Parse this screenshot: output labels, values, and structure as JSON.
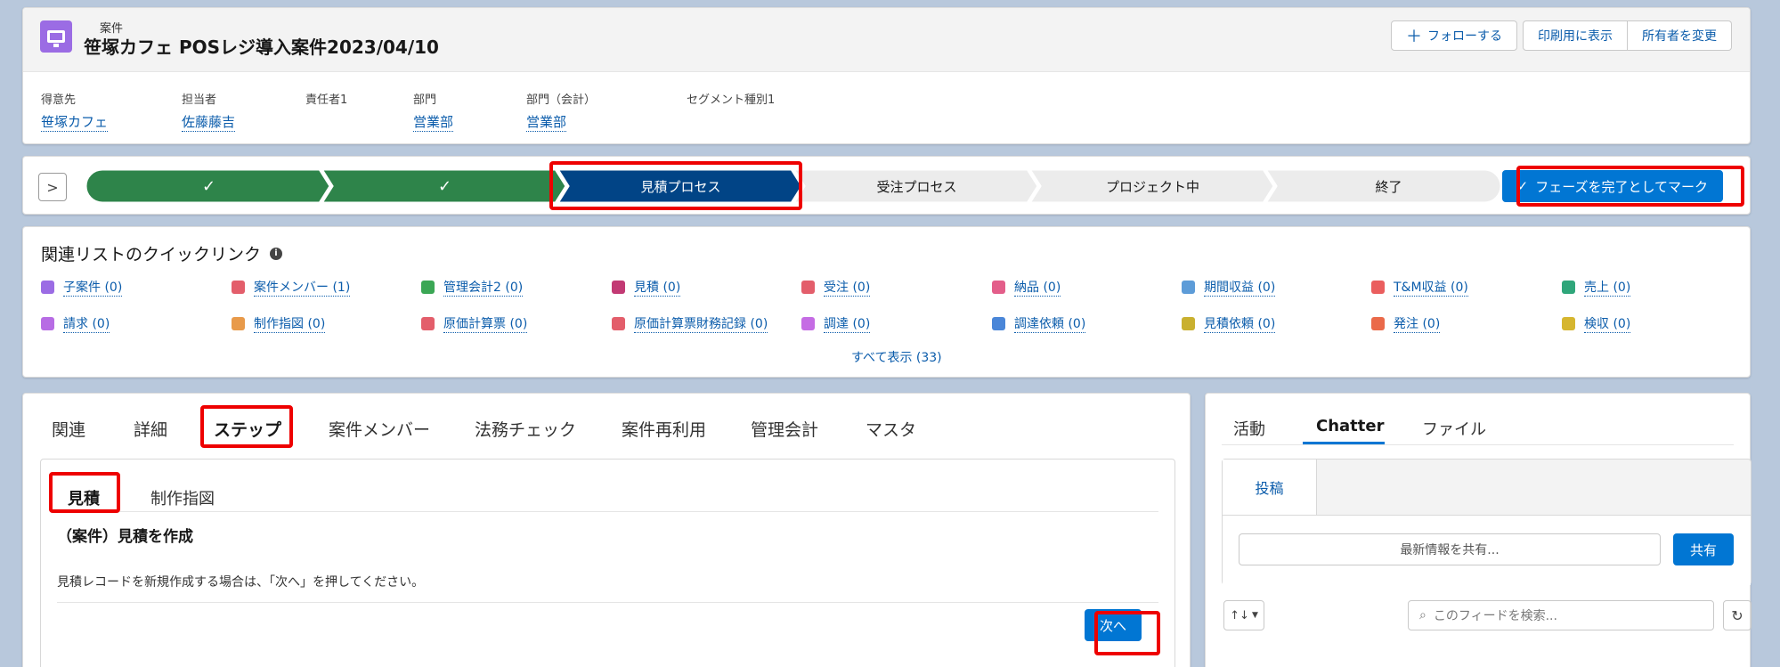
{
  "header": {
    "object_label": "案件",
    "record_title": "笹塚カフェ POSレジ導入案件2023/04/10",
    "buttons": {
      "follow": "フォローする",
      "printable": "印刷用に表示",
      "change_owner": "所有者を変更"
    },
    "fields": [
      {
        "label": "得意先",
        "value": "笹塚カフェ"
      },
      {
        "label": "担当者",
        "value": "佐藤藤吉"
      },
      {
        "label": "責任者1",
        "value": ""
      },
      {
        "label": "部門",
        "value": "営業部"
      },
      {
        "label": "部門（会計）",
        "value": "営業部"
      },
      {
        "label": "セグメント種別1",
        "value": ""
      }
    ]
  },
  "path": {
    "stages": [
      {
        "label": "✓",
        "status": "complete"
      },
      {
        "label": "✓",
        "status": "complete"
      },
      {
        "label": "見積プロセス",
        "status": "current"
      },
      {
        "label": "受注プロセス",
        "status": "incomplete"
      },
      {
        "label": "プロジェクト中",
        "status": "incomplete"
      },
      {
        "label": "終了",
        "status": "incomplete"
      }
    ],
    "mark_complete_button": "フェーズを完了としてマーク",
    "colors": {
      "complete": "#2e844a",
      "current": "#014486",
      "incomplete": "#ececec"
    }
  },
  "quick_links": {
    "title": "関連リストのクイックリンク",
    "items": [
      {
        "label": "子案件 (0)",
        "color": "#9b6ce4"
      },
      {
        "label": "案件メンバー (1)",
        "color": "#e35e6b"
      },
      {
        "label": "管理会計2 (0)",
        "color": "#3ba755"
      },
      {
        "label": "見積 (0)",
        "color": "#c23a74"
      },
      {
        "label": "受注 (0)",
        "color": "#e35e6b"
      },
      {
        "label": "納品 (0)",
        "color": "#e35e8a"
      },
      {
        "label": "期間収益 (0)",
        "color": "#5d9cd8"
      },
      {
        "label": "T&M収益 (0)",
        "color": "#ea5e5e"
      },
      {
        "label": "売上 (0)",
        "color": "#2fa67a"
      },
      {
        "label": "請求 (0)",
        "color": "#b76ce4"
      },
      {
        "label": "制作指図 (0)",
        "color": "#e89a4a"
      },
      {
        "label": "原価計算票 (0)",
        "color": "#e35e6b"
      },
      {
        "label": "原価計算票財務記録 (0)",
        "color": "#e35e6b"
      },
      {
        "label": "調達 (0)",
        "color": "#c56ce4"
      },
      {
        "label": "調達依頼 (0)",
        "color": "#4a86d8"
      },
      {
        "label": "見積依頼 (0)",
        "color": "#c9b02f"
      },
      {
        "label": "発注 (0)",
        "color": "#ea6a4a"
      },
      {
        "label": "検収 (0)",
        "color": "#d6b62f"
      }
    ],
    "show_all": "すべて表示 (33)"
  },
  "main_tabs": [
    "関連",
    "詳細",
    "ステップ",
    "案件メンバー",
    "法務チェック",
    "案件再利用",
    "管理会計",
    "マスタ"
  ],
  "step": {
    "subtabs": [
      "見積",
      "制作指図"
    ],
    "title": "（案件）見積を作成",
    "description": "見積レコードを新規作成する場合は、「次へ」を押してください。",
    "next_button": "次へ"
  },
  "right_panel": {
    "tabs": [
      "活動",
      "Chatter",
      "ファイル"
    ],
    "publisher_tab": "投稿",
    "share_placeholder": "最新情報を共有...",
    "share_button": "共有",
    "sort_label": "↑↓",
    "feed_search_placeholder": "このフィードを検索..."
  }
}
